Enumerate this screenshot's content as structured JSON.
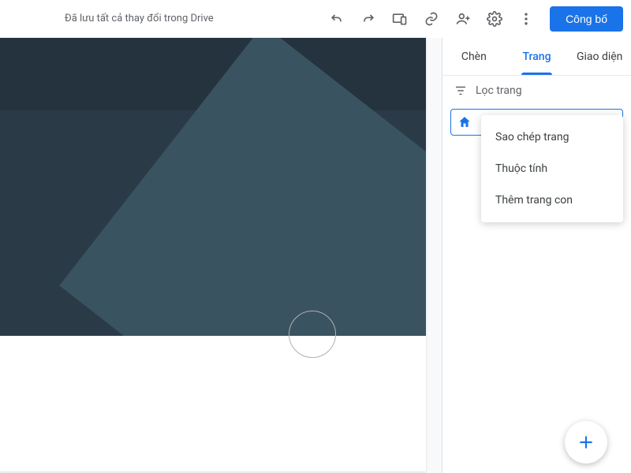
{
  "toolbar": {
    "status": "Đã lưu tất cả thay đổi trong Drive",
    "publish_label": "Công bố"
  },
  "sidebar": {
    "tabs": {
      "insert": "Chèn",
      "pages": "Trang",
      "themes": "Giao diện"
    },
    "filter_label": "Lọc trang",
    "page_item": {
      "name": ""
    }
  },
  "context_menu": {
    "duplicate": "Sao chép trang",
    "properties": "Thuộc tính",
    "add_subpage": "Thêm trang con"
  }
}
